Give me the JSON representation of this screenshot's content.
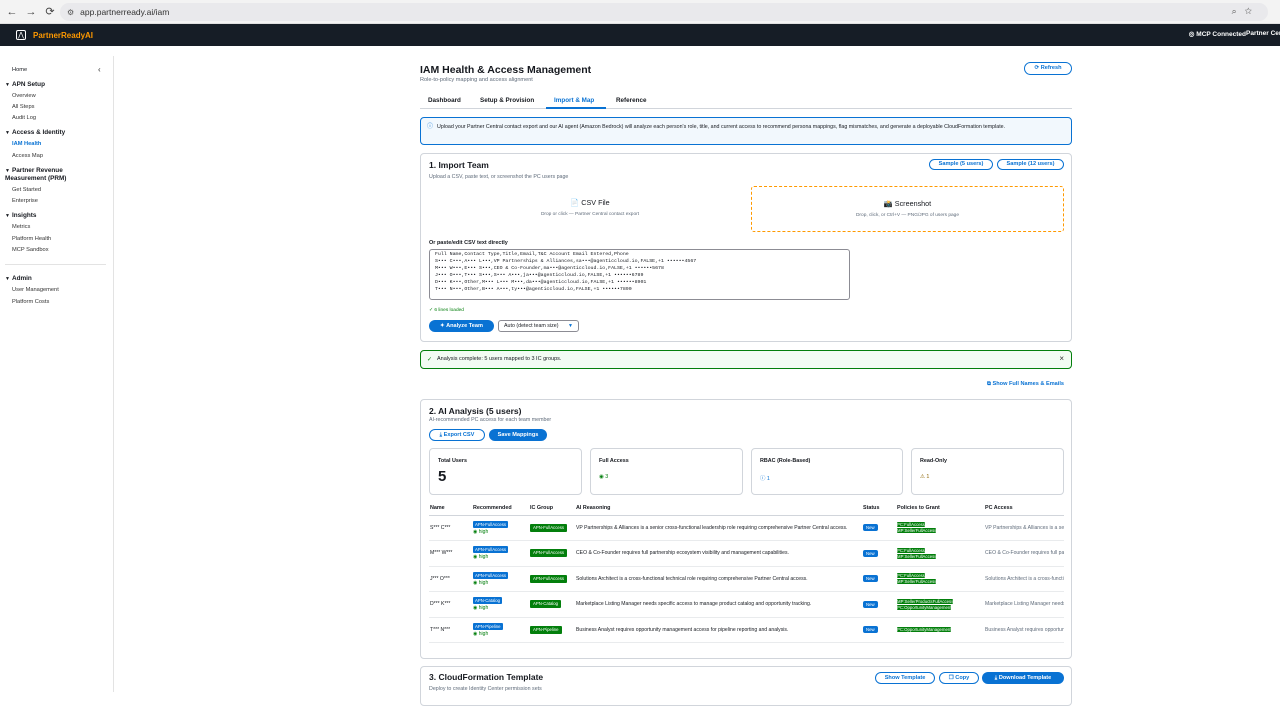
{
  "browser": {
    "url": "app.partnerready.ai/iam"
  },
  "topbar": {
    "brand": "PartnerReadyAI",
    "mcp": "MCP Connected",
    "partner": "Partner Central"
  },
  "sidebar": {
    "home": "Home",
    "sections": [
      {
        "title": "APN Setup",
        "items": [
          "Overview",
          "All Steps",
          "Audit Log"
        ]
      },
      {
        "title": "Access & Identity",
        "items": [
          "IAM Health",
          "Access Map"
        ]
      },
      {
        "title": "Partner Revenue Measurement (PRM)",
        "items": [
          "Get Started",
          "Enterprise"
        ]
      },
      {
        "title": "Insights",
        "items": [
          "Metrics",
          "Platform Health",
          "MCP Sandbox"
        ]
      },
      {
        "title": "Admin",
        "items": [
          "User Management",
          "Platform Costs"
        ]
      }
    ]
  },
  "page": {
    "title": "IAM Health & Access Management",
    "subtitle": "Role-to-policy mapping and access alignment",
    "refresh": "Refresh"
  },
  "tabs": [
    "Dashboard",
    "Setup & Provision",
    "Import & Map",
    "Reference"
  ],
  "info": "Upload your Partner Central contact export and our AI agent (Amazon Bedrock) will analyze each person's role, title, and current access to recommend persona mappings, flag mismatches, and generate a deployable CloudFormation template.",
  "import": {
    "title": "1. Import Team",
    "subtitle": "Upload a CSV, paste text, or screenshot the PC users page",
    "sample5": "Sample (5 users)",
    "sample12": "Sample (12 users)",
    "csv_title": "📄 CSV File",
    "csv_sub": "Drop or click — Partner Central contact export",
    "shot_title": "📸 Screenshot",
    "shot_sub": "Drop, click, or Ctrl+V — PNG/JPG of users page",
    "paste_label": "Or paste/edit CSV text directly",
    "csv_text": "Full Name,Contact Type,Title,Email,T&C Account Email Entered,Phone\nS••• C•••,A••• L•••,VP Partnerships & Alliances,sa•••@agenticcloud.io,FALSE,+1 ••••••4567\nM••• W•••,E••• S•••,CEO & Co-Founder,ma•••@agenticcloud.io,FALSE,+1 ••••••5678\nJ••• O•••,T••• S•••,S••• A•••,ja•••@agenticcloud.io,FALSE,+1 ••••••6789\nD••• K•••,Other,M••• L••• M•••,da•••@agenticcloud.io,FALSE,+1 ••••••8901\nT••• N•••,Other,B••• A•••,ty•••@agenticcloud.io,FALSE,+1 ••••••7890",
    "lines_loaded": "✓ 6 lines loaded",
    "analyze": "Analyze Team",
    "mode": "Auto (detect team size)"
  },
  "success": "Analysis complete: 5 users mapped to 3 IC groups.",
  "show_names": "Show Full Names & Emails",
  "analysis": {
    "title": "2. AI Analysis (5 users)",
    "subtitle": "AI-recommended PC access for each team member",
    "export": "Export CSV",
    "save": "Save Mappings",
    "cards": [
      {
        "label": "Total Users",
        "value": "5"
      },
      {
        "label": "Full Access",
        "value": "3"
      },
      {
        "label": "RBAC (Role-Based)",
        "value": "1"
      },
      {
        "label": "Read-Only",
        "value": "1"
      }
    ],
    "columns": [
      "Name",
      "Recommended",
      "IC Group",
      "AI Reasoning",
      "Status",
      "Policies to Grant",
      "PC Access"
    ],
    "rows": [
      {
        "name": "S*** C***",
        "rec": "APN-FullAccess",
        "conf": "high",
        "group": "APN-FullAccess",
        "reason": "VP Partnerships & Alliances is a senior cross-functional leadership role requiring comprehensive Partner Central access.",
        "status": "New",
        "policies": [
          "PC:FullAccess",
          "MP:SellerFullAccess"
        ],
        "pc": "VP Partnerships & Alliances is a senior cross-functional"
      },
      {
        "name": "M*** W***",
        "rec": "APN-FullAccess",
        "conf": "high",
        "group": "APN-FullAccess",
        "reason": "CEO & Co-Founder requires full partnership ecosystem visibility and management capabilities.",
        "status": "New",
        "policies": [
          "PC:FullAccess",
          "MP:SellerFullAccess"
        ],
        "pc": "CEO & Co-Founder requires full partnership"
      },
      {
        "name": "J*** O***",
        "rec": "APN-FullAccess",
        "conf": "high",
        "group": "APN-FullAccess",
        "reason": "Solutions Architect is a cross-functional technical role requiring comprehensive Partner Central access.",
        "status": "New",
        "policies": [
          "PC:FullAccess",
          "MP:SellerFullAccess"
        ],
        "pc": "Solutions Architect is a cross-functional"
      },
      {
        "name": "D*** K***",
        "rec": "APN-Catalog",
        "conf": "high",
        "group": "APN-Catalog",
        "reason": "Marketplace Listing Manager needs specific access to manage product catalog and opportunity tracking.",
        "status": "New",
        "policies": [
          "MP:SellerProductsFullAccess",
          "PC:OpportunityManagement"
        ],
        "pc": "Marketplace Listing Manager needs specific"
      },
      {
        "name": "T*** N***",
        "rec": "APN-Pipeline",
        "conf": "high",
        "group": "APN-Pipeline",
        "reason": "Business Analyst requires opportunity management access for pipeline reporting and analysis.",
        "status": "New",
        "policies": [
          "PC:OpportunityManagement"
        ],
        "pc": "Business Analyst requires opportunity management"
      }
    ]
  },
  "cloudformation": {
    "title": "3. CloudFormation Template",
    "subtitle": "Deploy to create Identity Center permission sets",
    "show": "Show Template",
    "copy": "Copy",
    "download": "Download Template"
  }
}
